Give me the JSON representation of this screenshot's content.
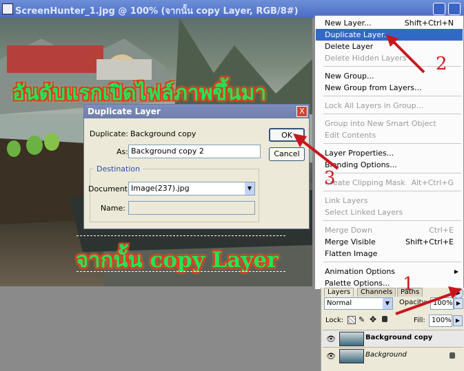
{
  "window": {
    "title": "ScreenHunter_1.jpg @ 100% (จากนั้น copy Layer, RGB/8#)"
  },
  "overlay_text": {
    "heading_top": "อันดับแรกเปิดไฟล์ภาพขึ้นมา",
    "heading_bottom": "จากนั้น copy Layer"
  },
  "dialog": {
    "title": "Duplicate Layer",
    "close_glyph": "X",
    "duplicate_label": "Duplicate:",
    "duplicate_value": "Background copy",
    "as_label": "As:",
    "as_value": "Background copy 2",
    "destination_legend": "Destination",
    "document_label": "Document:",
    "document_value": "Image(237).jpg",
    "name_label": "Name:",
    "name_value": "",
    "ok_label": "OK",
    "cancel_label": "Cancel"
  },
  "menu": {
    "items": [
      {
        "label": "New Layer...",
        "shortcut": "Shift+Ctrl+N"
      },
      {
        "label": "Duplicate Layer...",
        "shortcut": ""
      },
      {
        "label": "Delete Layer",
        "shortcut": ""
      },
      {
        "label": "Delete Hidden Layers",
        "shortcut": ""
      },
      {
        "label": "New Group...",
        "shortcut": ""
      },
      {
        "label": "New Group from Layers...",
        "shortcut": ""
      },
      {
        "label": "Lock All Layers in Group...",
        "shortcut": ""
      },
      {
        "label": "Group into New Smart Object",
        "shortcut": ""
      },
      {
        "label": "Edit Contents",
        "shortcut": ""
      },
      {
        "label": "Layer Properties...",
        "shortcut": ""
      },
      {
        "label": "Blending Options...",
        "shortcut": ""
      },
      {
        "label": "Create Clipping Mask",
        "shortcut": "Alt+Ctrl+G"
      },
      {
        "label": "Link Layers",
        "shortcut": ""
      },
      {
        "label": "Select Linked Layers",
        "shortcut": ""
      },
      {
        "label": "Merge Down",
        "shortcut": "Ctrl+E"
      },
      {
        "label": "Merge Visible",
        "shortcut": "Shift+Ctrl+E"
      },
      {
        "label": "Flatten Image",
        "shortcut": ""
      },
      {
        "label": "Animation Options",
        "shortcut": ""
      },
      {
        "label": "Palette Options...",
        "shortcut": ""
      }
    ]
  },
  "palette": {
    "tab_layers": "Layers",
    "tab_channels": "Channels",
    "tab_paths": "Paths",
    "blend_mode": "Normal",
    "opacity_label": "Opacity:",
    "opacity_value": "100%",
    "lock_label": "Lock:",
    "fill_label": "Fill:",
    "fill_value": "100%",
    "layers": [
      {
        "name": "Background copy"
      },
      {
        "name": "Background"
      }
    ]
  },
  "annotations": {
    "step1": "1",
    "step2": "2",
    "step3": "3"
  },
  "colors": {
    "menu_highlight": "#316ac5",
    "annotation_red": "#c8161d",
    "heading_green": "#1ee65a"
  }
}
